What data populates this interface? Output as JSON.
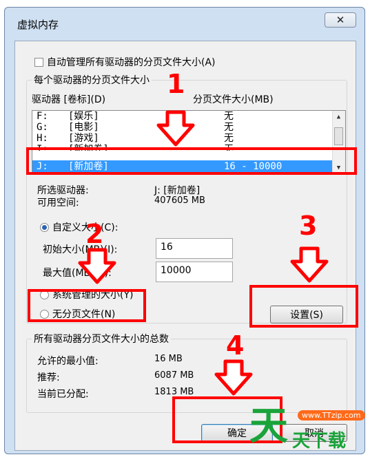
{
  "dialog": {
    "title": "虚拟内存",
    "close_glyph": "✕"
  },
  "auto_manage": {
    "checked": false,
    "label": "自动管理所有驱动器的分页文件大小(A)"
  },
  "per_drive_group": {
    "legend": "每个驱动器的分页文件大小",
    "col_drive": "驱动器 [卷标](D)",
    "col_size": "分页文件大小(MB)",
    "rows": [
      {
        "drive": "F:",
        "label": "[娱乐]",
        "size": "无"
      },
      {
        "drive": "G:",
        "label": "[电影]",
        "size": "无"
      },
      {
        "drive": "H:",
        "label": "[游戏]",
        "size": "无"
      },
      {
        "drive": "I:",
        "label": "[新加卷]",
        "size": "无"
      },
      {
        "drive": "J:",
        "label": "[新加卷]",
        "size": "16 - 10000"
      }
    ],
    "selected_row": 4,
    "selected_drive_label": "所选驱动器:",
    "selected_drive_value": "J:  [新加卷]",
    "free_space_label": "可用空间:",
    "free_space_value": "407605 MB",
    "custom_size_label": "自定义大小(C):",
    "initial_size_label": "初始大小(MB)(I):",
    "initial_size_value": "16",
    "max_size_label": "最大值(MB)(X):",
    "max_size_value": "10000",
    "system_managed_label": "系统管理的大小(Y)",
    "no_paging_label": "无分页文件(N)",
    "selected_option": "custom",
    "set_button": "设置(S)"
  },
  "totals_group": {
    "legend": "所有驱动器分页文件大小的总数",
    "min_label": "允许的最小值:",
    "min_value": "16 MB",
    "recommended_label": "推荐:",
    "recommended_value": "6087 MB",
    "allocated_label": "当前已分配:",
    "allocated_value": "1813 MB"
  },
  "footer": {
    "ok_button": "确定",
    "cancel_button": "取消"
  },
  "annotations": {
    "step1": "1",
    "step2": "2",
    "step3": "3",
    "step4": "4",
    "color": "#ff0000"
  },
  "watermark": {
    "url": "www.TTzip.com",
    "brand": "天下载",
    "brand_color": "#1aa33a"
  }
}
